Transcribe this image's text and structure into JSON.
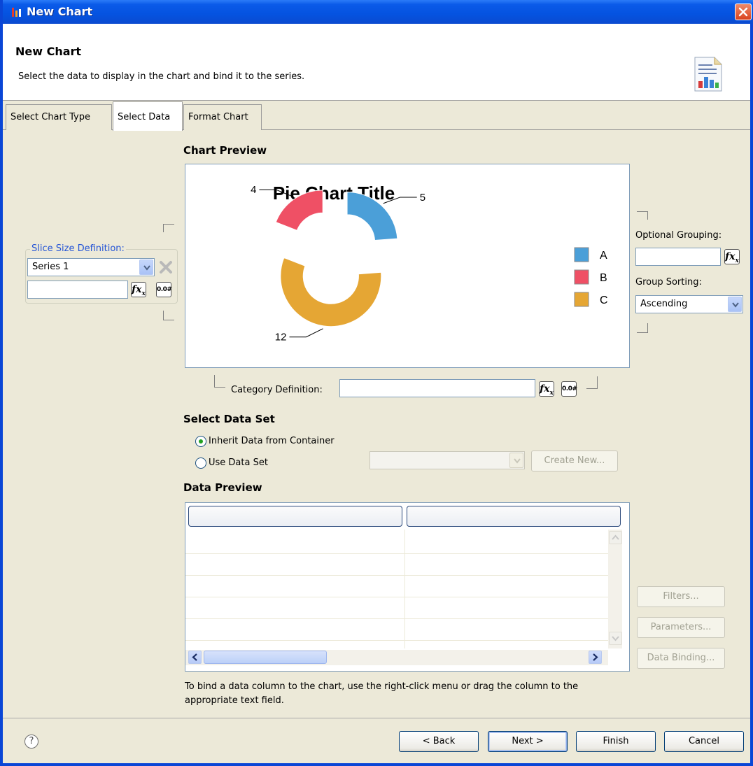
{
  "window": {
    "title": "New Chart"
  },
  "header": {
    "title": "New Chart",
    "description": "Select the data to display in the chart and bind it to the series."
  },
  "tabs": [
    {
      "label": "Select Chart Type",
      "active": false
    },
    {
      "label": "Select Data",
      "active": true
    },
    {
      "label": "Format Chart",
      "active": false
    }
  ],
  "chart_preview": {
    "heading": "Chart Preview"
  },
  "chart_data": {
    "type": "pie",
    "title": "Pie Chart Title",
    "categories": [
      "A",
      "B",
      "C"
    ],
    "values": [
      5,
      4,
      12
    ],
    "colors": [
      "#4b9fd8",
      "#ef5065",
      "#e5a634"
    ],
    "legend_position": "right"
  },
  "slice_size": {
    "legend": "Slice Size Definition:",
    "series_value": "Series 1",
    "expression_value": ""
  },
  "category": {
    "label": "Category Definition:",
    "value": ""
  },
  "grouping": {
    "optional_label": "Optional Grouping:",
    "optional_value": "",
    "sorting_label": "Group Sorting:",
    "sorting_value": "Ascending"
  },
  "icons": {
    "fx": "fx",
    "sub": "x",
    "format": "0.0#",
    "help": "?"
  },
  "data_set": {
    "heading": "Select Data Set",
    "inherit_label": "Inherit Data from Container",
    "use_label": "Use Data Set",
    "use_value": "",
    "create_new_label": "Create New...",
    "selected": "inherit"
  },
  "data_preview": {
    "heading": "Data Preview",
    "columns": [
      "",
      ""
    ],
    "filters_label": "Filters...",
    "parameters_label": "Parameters...",
    "data_binding_label": "Data Binding..."
  },
  "note": "To bind a data column to the chart, use the right-click menu or drag the column to the appropriate text field.",
  "footer": {
    "back_label": "< Back",
    "next_label": "Next >",
    "finish_label": "Finish",
    "cancel_label": "Cancel"
  }
}
